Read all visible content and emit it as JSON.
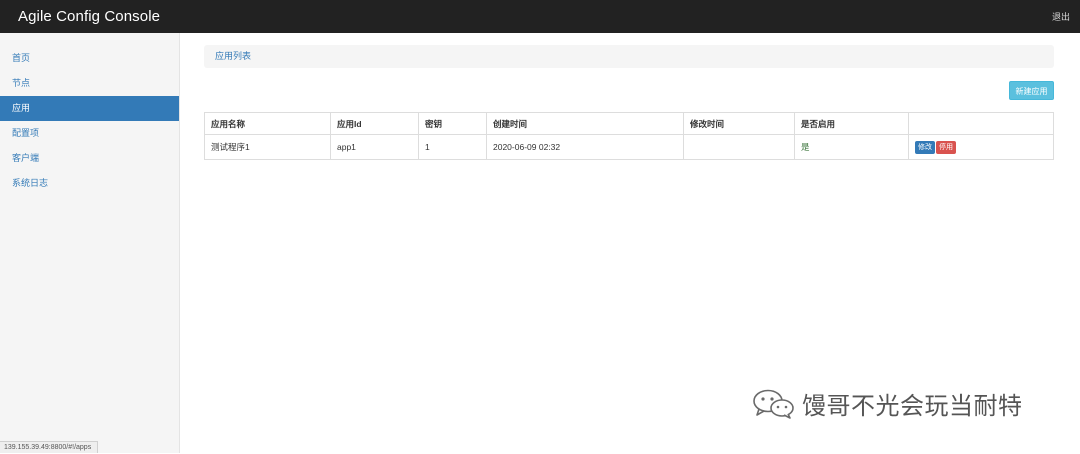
{
  "navbar": {
    "brand": "Agile Config Console",
    "logout_label": "退出"
  },
  "sidebar": {
    "items": [
      {
        "label": "首页",
        "active": false
      },
      {
        "label": "节点",
        "active": false
      },
      {
        "label": "应用",
        "active": true
      },
      {
        "label": "配置项",
        "active": false
      },
      {
        "label": "客户端",
        "active": false
      },
      {
        "label": "系统日志",
        "active": false
      }
    ]
  },
  "main": {
    "breadcrumb": "应用列表",
    "new_button_label": "新建应用",
    "table": {
      "headers": [
        "应用名称",
        "应用Id",
        "密钥",
        "创建时间",
        "修改时间",
        "是否启用",
        ""
      ],
      "rows": [
        {
          "name": "测试程序1",
          "app_id": "app1",
          "secret": "1",
          "created": "2020-06-09 02:32",
          "modified": "",
          "enabled": "是",
          "edit_label": "修改",
          "disable_label": "停用"
        }
      ]
    }
  },
  "status_url": "139.155.39.49:8800/#!/apps",
  "watermark": {
    "text": "馒哥不光会玩当耐特",
    "icon": "wechat-icon"
  },
  "colors": {
    "navbar_bg": "#222222",
    "accent": "#337ab7",
    "info": "#5bc0de",
    "danger": "#d9534f",
    "success_text": "#3c763d"
  }
}
